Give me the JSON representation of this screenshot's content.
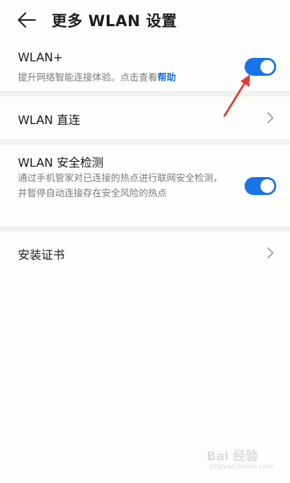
{
  "header": {
    "title": "更多 WLAN 设置",
    "back_icon": "arrow-left-icon"
  },
  "items": [
    {
      "title": "WLAN+",
      "subtitle_prefix": "提升网络智能连接体验。点击查看",
      "subtitle_link": "帮助",
      "toggle_on": true
    },
    {
      "title": "WLAN 直连",
      "chevron": "chevron-right-icon"
    },
    {
      "title": "WLAN 安全检测",
      "subtitle": "通过手机管家对已连接的热点进行联网安全检测，并暂停自动连接存在安全风险的热点",
      "toggle_on": true
    },
    {
      "title": "安装证书",
      "chevron": "chevron-right-icon"
    }
  ],
  "watermark": {
    "text": "Bai 经验",
    "sub": "jingyan.baidu.com"
  },
  "colors": {
    "accent": "#1a73e8",
    "annotation": "#e53935",
    "separator": "#f0f0ee"
  }
}
